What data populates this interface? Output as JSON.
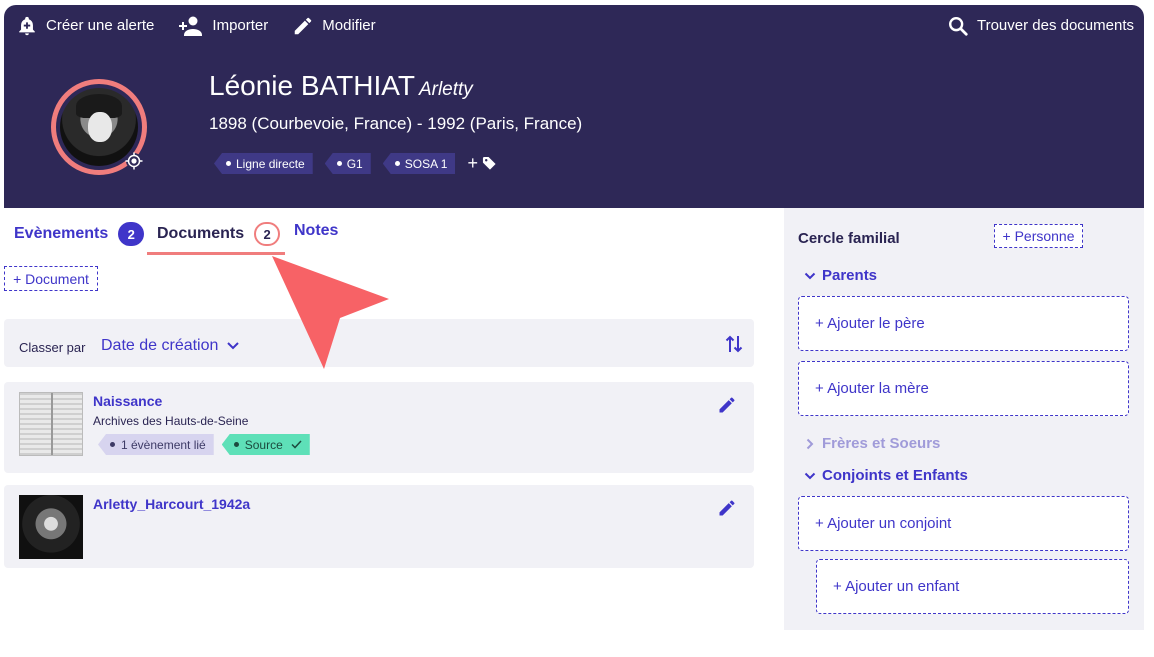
{
  "toolbar": {
    "create_alert": "Créer une alerte",
    "import": "Importer",
    "edit": "Modifier",
    "find_documents": "Trouver des documents"
  },
  "profile": {
    "name": "Léonie BATHIAT",
    "nickname": "Arletty",
    "dates": "1898 (Courbevoie, France) - 1992 (Paris, France)",
    "tags": [
      "Ligne directe",
      "G1",
      "SOSA 1"
    ],
    "add_tag": "+"
  },
  "tabs": {
    "events": {
      "label": "Evènements",
      "count": "2"
    },
    "documents": {
      "label": "Documents",
      "count": "2"
    },
    "notes": {
      "label": "Notes"
    }
  },
  "actions": {
    "add_document": "+ Document"
  },
  "sort": {
    "label": "Classer par",
    "selected": "Date de création"
  },
  "documents": [
    {
      "title": "Naissance",
      "source": "Archives des Hauts-de-Seine",
      "linked_events": "1 évènement lié",
      "source_tag": "Source"
    },
    {
      "title": "Arletty_Harcourt_1942a"
    }
  ],
  "family": {
    "title": "Cercle familial",
    "add_person": "+ Personne",
    "parents": "Parents",
    "add_father": "+ Ajouter le père",
    "add_mother": "+ Ajouter la mère",
    "siblings": "Frères et Soeurs",
    "spouses_children": "Conjoints et Enfants",
    "add_spouse": "+ Ajouter un conjoint",
    "add_child": "+ Ajouter un enfant"
  },
  "colors": {
    "header_bg": "#2e2857",
    "accent": "#3f35c9",
    "highlight": "#f07d7d",
    "source_tag": "#5ee0b8"
  }
}
